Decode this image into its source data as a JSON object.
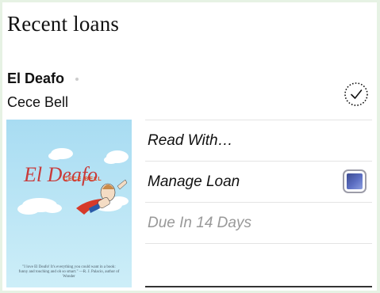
{
  "section": {
    "title": "Recent loans"
  },
  "book": {
    "title": "El Deafo",
    "author": "Cece Bell",
    "cover": {
      "title_art": "El Deafo",
      "author_art": "CECE BELL",
      "quote": "\"I love El Deafo! It's everything you could want in a book: funny and touching and oh so smart.\" —R. J. Palacio, author of Wonder"
    }
  },
  "menu": {
    "items": [
      {
        "label": "Read With…",
        "kind": "action"
      },
      {
        "label": "Manage Loan",
        "kind": "action",
        "icon": "manage-loan-icon"
      },
      {
        "label": "Due In 14 Days",
        "kind": "status"
      }
    ]
  },
  "icons": {
    "status": "dotted-check-circle-icon"
  },
  "colors": {
    "page_bg": "#e6f2e4",
    "cover_bg": "#bfe6f4",
    "accent_blue": "#4a5ca8",
    "muted_text": "#999999"
  }
}
